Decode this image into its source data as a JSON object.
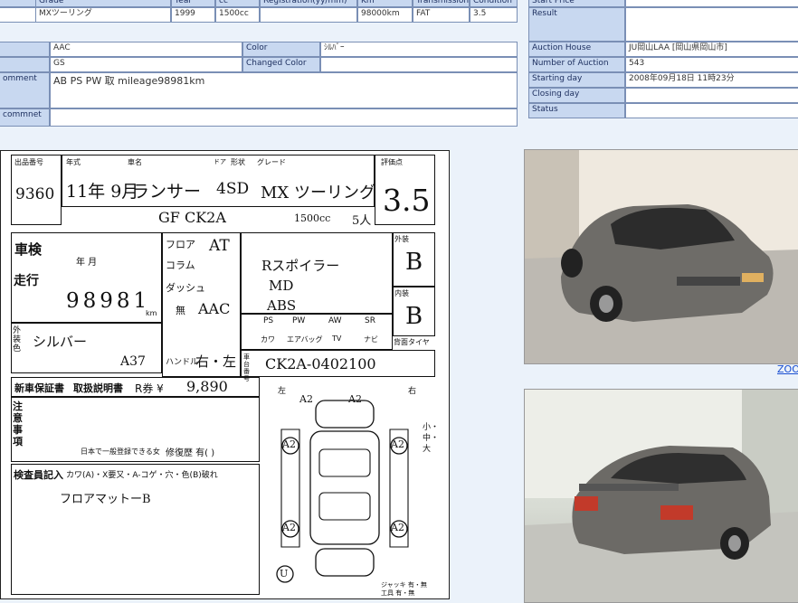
{
  "top_table": {
    "headers": [
      "Grade",
      "Year",
      "cc",
      "Registration(yy/mm)",
      "Km",
      "Transmission",
      "Condition"
    ],
    "values": [
      "MXツーリング",
      "1999",
      "1500cc",
      "",
      "98000km",
      "FAT",
      "3.5"
    ]
  },
  "info_table": {
    "equipment_label": "",
    "equipment_value": "AAC",
    "color_label": "Color",
    "color_value": "ｼﾙﾊﾞｰ",
    "grade_label": "",
    "grade_value": "GS",
    "changed_color_label": "Changed Color",
    "changed_color_value": "",
    "comment_label": "omment",
    "comment_value": "AB PS PW 取 mileage98981km",
    "commnet_label": "commnet",
    "commnet_value": ""
  },
  "auction_table": {
    "start_price_label": "Start Price",
    "start_price_value": "",
    "result_label": "Result",
    "result_value": "",
    "house_label": "Auction House",
    "house_value": "JU岡山LAA [岡山県岡山市]",
    "number_label": "Number of Auction",
    "number_value": "543",
    "starting_label": "Starting day",
    "starting_value": "2008年09月18日 11時23分",
    "closing_label": "Closing day",
    "closing_value": "",
    "status_label": "Status",
    "status_value": ""
  },
  "sheet": {
    "lot_label": "出品番号",
    "lot_no": "9360",
    "year_label": "年式",
    "year_value": "11年 9月",
    "name_label": "車名",
    "name_value": "ランサー",
    "door_label": "ドア",
    "shape_label": "形状",
    "shape_value": "4SD",
    "grade_label": "グレード",
    "grade_value": "MX ツーリング",
    "score_label": "評価点",
    "score_value": "3.5",
    "model_value": "GF  CK2A",
    "cc_value": "1500cc",
    "seats_value": "5人",
    "shaken_label": "車検",
    "shaken_ym": "年    月",
    "mileage_label": "走行",
    "mileage_value": "98981",
    "mileage_unit": "km",
    "ext_color_label": "外装色",
    "ext_color_value": "シルバー",
    "color_no": "A37",
    "shift_values": [
      "フロア",
      "コラム",
      "ダッシュ"
    ],
    "shift_at": "AT",
    "aac_label": "無",
    "aac_value": "AAC",
    "sales_points": [
      "Rスポイラー",
      "MD",
      "ABS"
    ],
    "equip_row1": [
      "PS",
      "PW",
      "AW",
      "SR"
    ],
    "equip_row2": [
      "カワ",
      "エアバッグ",
      "TV",
      "ナビ"
    ],
    "handle_label": "ハンドル",
    "handle_value": "右・左",
    "frame_label": "車台番号",
    "frame_value": "CK2A-0402100",
    "ext_grade_label": "外装",
    "ext_grade_value": "B",
    "int_grade_label": "内装",
    "int_grade_value": "B",
    "tire_label": "背面タイヤ",
    "warranty_label": "新車保証書",
    "manual_label": "取扱説明書",
    "recycle_label": "R券 ¥",
    "recycle_value": "9,890",
    "notes_label": "注意事項",
    "dealer_label": "日本で一般登録できる女",
    "history_label": "修復歴  有(      )",
    "inspector_label": "検査員記入",
    "inspector_marks": "カワ(A)・X要又・A-コゲ・穴・色(B)破れ",
    "inspector_note": "フロアマットーB",
    "diagram_left": "左",
    "diagram_right": "右",
    "diagram_side_marks": "小・中・大",
    "diagram_bottom": "ジャッキ 有・無  工具 有・無",
    "diagram_marks": [
      "A2",
      "A2",
      "A2",
      "A2",
      "A2",
      "A2",
      "U"
    ]
  },
  "photos": {
    "zoom_label": "ZOO"
  },
  "colors": {
    "header_bg": "#c8d8f0",
    "border": "#7a8fb5",
    "page_bg": "#ebf2fa",
    "link": "#1a4fd1"
  }
}
